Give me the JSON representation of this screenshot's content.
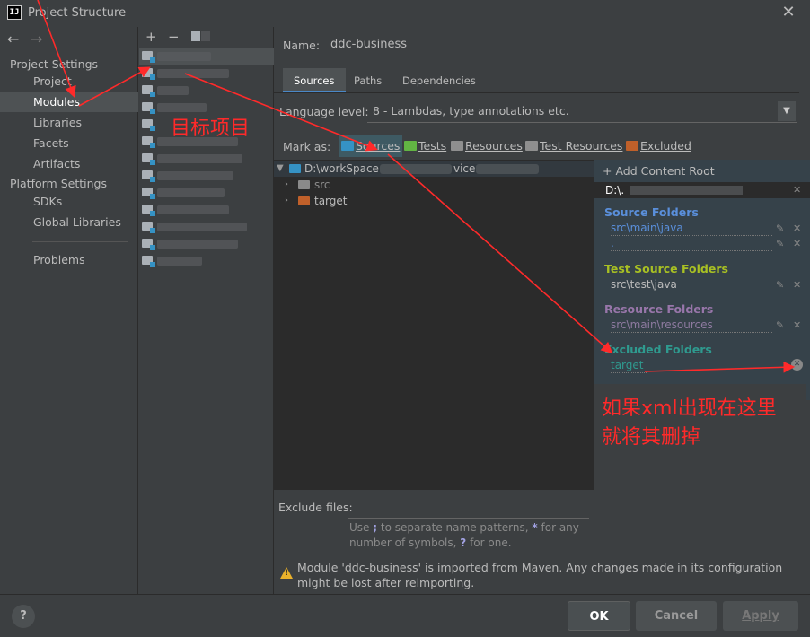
{
  "window": {
    "title": "Project Structure",
    "logo": "IJ"
  },
  "nav": {
    "back": "←",
    "forward": "→"
  },
  "sidebar": {
    "project_settings": "Project Settings",
    "project_items": [
      "Project",
      "Modules",
      "Libraries",
      "Facets",
      "Artifacts"
    ],
    "platform_settings": "Platform Settings",
    "platform_items": [
      "SDKs",
      "Global Libraries"
    ],
    "problems": "Problems",
    "selected": "Modules"
  },
  "modules_toolbar": {
    "add": "+",
    "remove": "−"
  },
  "module": {
    "name_label": "Name:",
    "name_value": "ddc-business",
    "tabs": [
      "Sources",
      "Paths",
      "Dependencies"
    ],
    "active_tab": "Sources",
    "language_level_label": "Language level:",
    "language_level_value": "8 - Lambdas, type annotations etc.",
    "mark_as_label": "Mark as:",
    "mark_as": [
      "Sources",
      "Tests",
      "Resources",
      "Test Resources",
      "Excluded"
    ]
  },
  "tree": {
    "root": "D:\\workSpace",
    "root_suffix": "vice",
    "children": [
      "src",
      "target"
    ]
  },
  "content_root": {
    "add_label": "+ Add Content Root",
    "path": "D:\\.",
    "groups": [
      {
        "title": "Source Folders",
        "color": "#5a8fdb",
        "items": [
          "src\\main\\java",
          "."
        ]
      },
      {
        "title": "Test Source Folders",
        "color": "#a8c023",
        "items": [
          "src\\test\\java"
        ]
      },
      {
        "title": "Resource Folders",
        "color": "#9876aa",
        "items": [
          "src\\main\\resources"
        ]
      },
      {
        "title": "Excluded Folders",
        "color": "#2f9a8f",
        "items": [
          "target"
        ]
      }
    ]
  },
  "exclude": {
    "label": "Exclude files:",
    "hint_1": "Use",
    "hint_sep": ";",
    "hint_2": "to separate name patterns,",
    "hint_star": "*",
    "hint_3": "for any number of symbols,",
    "hint_q": "?",
    "hint_4": "for one."
  },
  "warning": "Module 'ddc-business' is imported from Maven. Any changes made in its configuration might be lost after reimporting.",
  "buttons": {
    "help": "?",
    "ok": "OK",
    "cancel": "Cancel",
    "apply": "Apply"
  },
  "annotations": {
    "target_project": "目标项目",
    "delete_hint_line1": "如果xml出现在这里",
    "delete_hint_line2": "就将其删掉"
  },
  "colors": {
    "annotation": "#ff2a2a",
    "sources": "#3592c4",
    "tests": "#62b543",
    "resources": "#9876aa",
    "excluded": "#c0602a"
  }
}
